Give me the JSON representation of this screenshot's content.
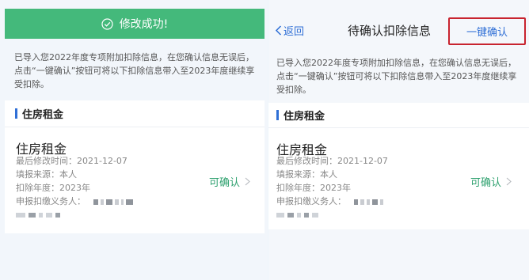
{
  "left": {
    "success_text": "修改成功!",
    "notice": "已导入您2022年度专项附加扣除信息，在您确认信息无误后，点击“一键确认”按钮可将以下扣除信息带入至2023年度继续享受扣除。",
    "section_title": "住房租金",
    "item": {
      "title": "住房租金",
      "modified": "最后修改时间：2021-12-07",
      "source": "填报来源：本人",
      "year": "扣除年度：2023年",
      "agent_label": "申报扣缴义务人：",
      "action": "可确认"
    }
  },
  "right": {
    "back_label": "返回",
    "title": "待确认扣除信息",
    "confirm_all": "一键确认",
    "notice": "已导入您2022年度专项附加扣除信息，在您确认信息无误后，点击“一键确认”按钮可将以下扣除信息带入至2023年度继续享受扣除。",
    "section_title": "住房租金",
    "item": {
      "title": "住房租金",
      "modified": "最后修改时间：2021-12-07",
      "source": "填报来源：本人",
      "year": "扣除年度：2023年",
      "agent_label": "申报扣缴义务人：",
      "action": "可确认"
    }
  },
  "colors": {
    "success_green": "#44b97b",
    "link_blue": "#2f6fd6",
    "action_green": "#2fa16f",
    "highlight_red": "#c8242f"
  },
  "icons": [
    "check-circle-icon",
    "back-chevron-icon",
    "chevron-right-icon"
  ]
}
